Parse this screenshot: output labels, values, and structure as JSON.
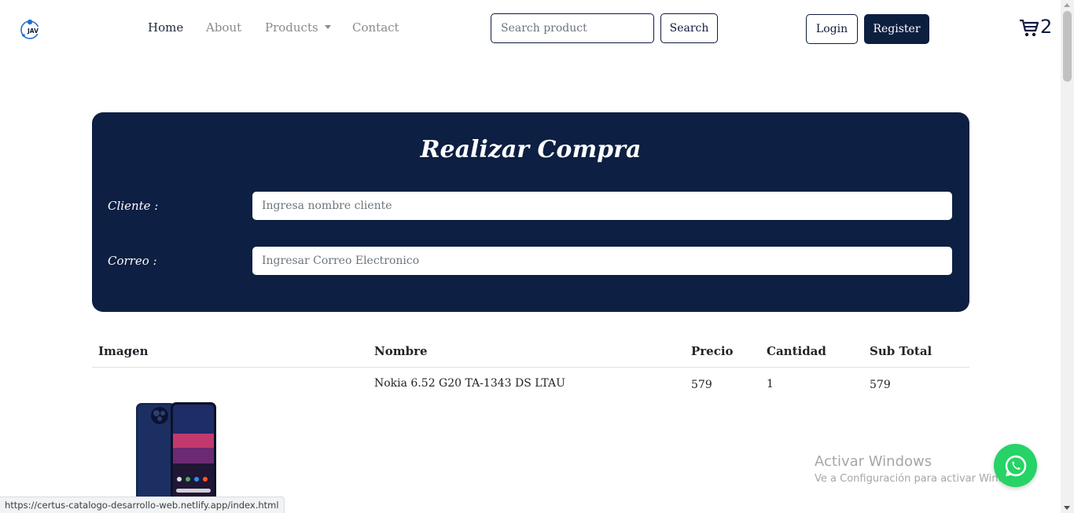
{
  "navbar": {
    "links": [
      "Home",
      "About",
      "Products",
      "Contact"
    ],
    "search_placeholder": "Search product",
    "search_button": "Search",
    "login_button": "Login",
    "register_button": "Register",
    "cart_count": "2",
    "logo_text": "JAV"
  },
  "purchase": {
    "title": "Realizar Compra",
    "cliente_label": "Cliente :",
    "cliente_placeholder": "Ingresa nombre cliente",
    "correo_label": "Correo :",
    "correo_placeholder": "Ingresar Correo Electronico"
  },
  "table": {
    "headers": [
      "Imagen",
      "Nombre",
      "Precio",
      "Cantidad",
      "Sub Total"
    ],
    "rows": [
      {
        "nombre": "Nokia 6.52 G20 TA-1343 DS LTAU",
        "precio": "579",
        "cantidad": "1",
        "subtotal": "579"
      }
    ]
  },
  "watermark": {
    "title": "Activar Windows",
    "subtitle": "Ve a Configuración para activar Windows."
  },
  "status_url": "https://certus-catalogo-desarrollo-web.netlify.app/index.html",
  "colors": {
    "primary": "#0d1f42",
    "whatsapp": "#25d366"
  },
  "icons": [
    "cart-icon",
    "whatsapp-icon",
    "logo-icon"
  ]
}
